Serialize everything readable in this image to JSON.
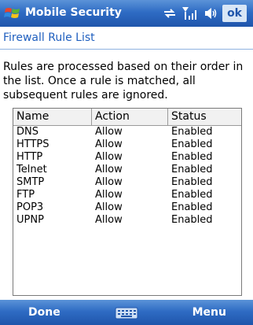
{
  "titlebar": {
    "app_title": "Mobile Security",
    "ok_label": "ok",
    "icons": [
      "windows-start-icon",
      "connectivity-icon",
      "signal-icon",
      "volume-icon"
    ]
  },
  "page": {
    "title": "Firewall Rule List",
    "description": "Rules are processed based on their order in the list. Once a rule is matched, all subsequent rules are ignored."
  },
  "table": {
    "columns": [
      "Name",
      "Action",
      "Status"
    ],
    "rows": [
      [
        "DNS",
        "Allow",
        "Enabled"
      ],
      [
        "HTTPS",
        "Allow",
        "Enabled"
      ],
      [
        "HTTP",
        "Allow",
        "Enabled"
      ],
      [
        "Telnet",
        "Allow",
        "Enabled"
      ],
      [
        "SMTP",
        "Allow",
        "Enabled"
      ],
      [
        "FTP",
        "Allow",
        "Enabled"
      ],
      [
        "POP3",
        "Allow",
        "Enabled"
      ],
      [
        "UPNP",
        "Allow",
        "Enabled"
      ]
    ]
  },
  "softkeys": {
    "left": "Done",
    "right": "Menu",
    "center_icon": "keyboard-icon"
  },
  "colors": {
    "bar_blue": "#2f6cc4",
    "title_blue": "#1f5fbf"
  }
}
